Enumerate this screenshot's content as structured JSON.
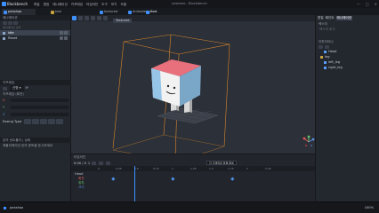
{
  "app": {
    "name": "Blockbench",
    "window_title": "peashoo - Blockbench"
  },
  "menu": [
    "파일",
    "편집",
    "애니메이션",
    "키프레임",
    "타임라인",
    "도구",
    "보기",
    "도움"
  ],
  "tabs": [
    {
      "label": "peashoo",
      "active": true,
      "color": "#3e90ff"
    },
    {
      "label": "test",
      "active": false,
      "color": "#c9a33d"
    },
    {
      "label": "textured",
      "active": false,
      "color": "#3e90ff"
    },
    {
      "label": "Animated_Java",
      "active": false,
      "color": "#3e90ff"
    },
    {
      "label": "Rest",
      "active": false,
      "color": "#3e90ff"
    }
  ],
  "viewport": {
    "view_mode": "Textured",
    "title_hint": "Blockbench"
  },
  "left_panel": {
    "animations_header": "애니메이션",
    "animation_placeholder": "애니메이션 검색",
    "animations": [
      {
        "label": "idle",
        "selected": true
      },
      {
        "label": "Reset",
        "selected": false
      }
    ],
    "keyframe_header": "키프레임",
    "keyframe_channel": "선형 ▾",
    "keyframe_sub": "키프레임 (회전)",
    "axes": [
      "X",
      "Y",
      "Z"
    ],
    "interpolation_label": "Easing Type",
    "bottom_header": "본의 컨트롤러 | 상태",
    "bottom_text": "애플리케이션 본의 중독을 표시하세요"
  },
  "right_panel": {
    "top_tabs": [
      "편집",
      "페인트",
      "애니메이션"
    ],
    "texture_header": "텍스처",
    "texture_hint": "텍스처 추가",
    "outliner_header": "아웃라이너",
    "outliner": [
      {
        "label": "Head",
        "level": 1,
        "color": "#5aa1ff"
      },
      {
        "label": "leg",
        "level": 0,
        "color": "#c9a33d"
      },
      {
        "label": "left_leg",
        "level": 1,
        "color": "#5aa1ff"
      },
      {
        "label": "right_leg",
        "level": 1,
        "color": "#5aa1ff"
      }
    ]
  },
  "timeline": {
    "header": "타임라인",
    "time_display": "0:00 / 0",
    "speed": "1",
    "tooltip": "키 프레임과 함께 재생",
    "ticks": [
      "0",
      "0.25",
      "0.5",
      "0.75",
      "1",
      "1.25",
      "1.5",
      "1.75",
      "2",
      "2.25"
    ],
    "rows": [
      {
        "label": "Head"
      },
      {
        "label": "회전"
      },
      {
        "label": "위치"
      },
      {
        "label": "크기"
      }
    ]
  },
  "statusbar": {
    "project": "peashoo",
    "zoom": "100%"
  }
}
